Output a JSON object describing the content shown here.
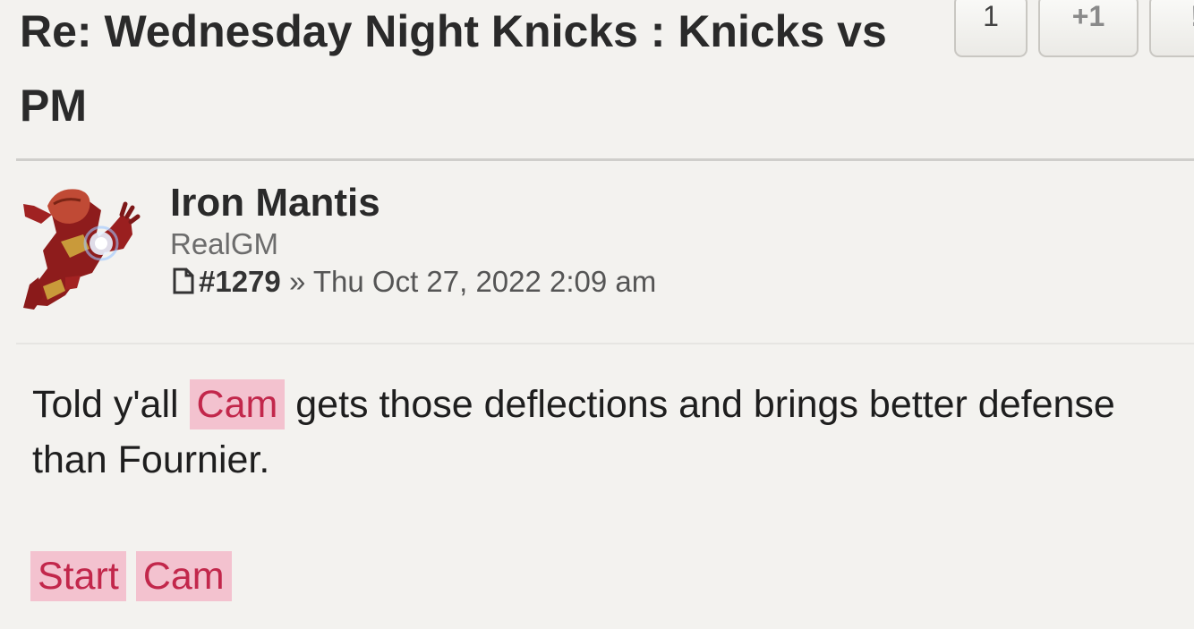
{
  "topic": {
    "title_line1": "Re: Wednesday Night Knicks : Knicks vs",
    "title_line2": "PM"
  },
  "post_buttons": {
    "quote_label": "1",
    "plus_label": "+1",
    "more_label": "!"
  },
  "post": {
    "author": {
      "name": "Iron Mantis",
      "rank": "RealGM",
      "avatar_icon": "iron-man-mantis-avatar"
    },
    "number": "#1279",
    "separator": "»",
    "date": "Thu Oct 27, 2022 2:09 am",
    "body": {
      "text_before": "Told y'all",
      "highlight": "Cam",
      "text_after": "gets those deflections and brings better defense",
      "line2": "than Fournier.",
      "tags": [
        "Start",
        "Cam"
      ]
    }
  },
  "colors": {
    "background": "#f3f2ef",
    "highlight_bg": "#f3c2cf",
    "highlight_text": "#c2274b"
  }
}
